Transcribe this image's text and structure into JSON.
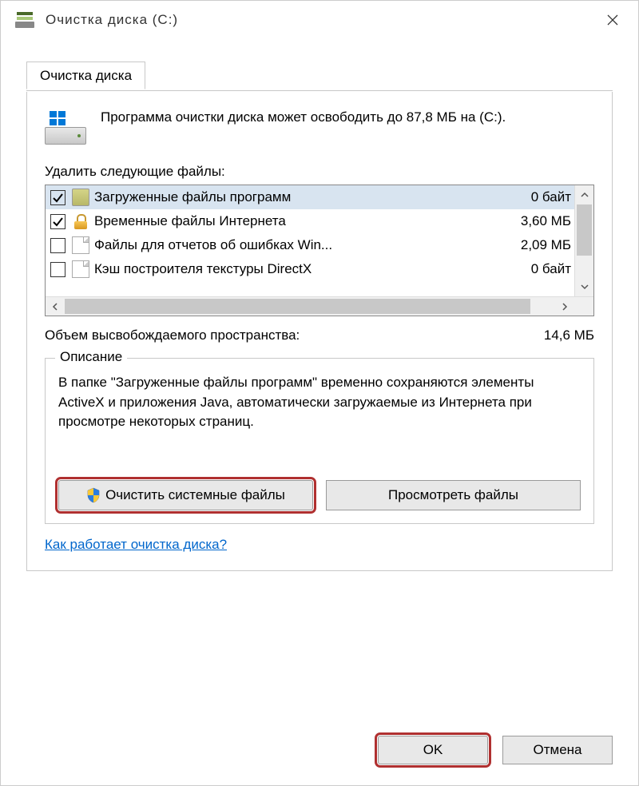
{
  "titlebar": {
    "title": "Очистка диска  (C:)"
  },
  "tab": {
    "label": "Очистка диска"
  },
  "info": {
    "text": "Программа очистки диска может освободить до 87,8 МБ на  (C:)."
  },
  "list": {
    "label": "Удалить следующие файлы:",
    "items": [
      {
        "name": "Загруженные файлы программ",
        "size": "0 байт",
        "checked": true,
        "icon": "folder",
        "selected": true
      },
      {
        "name": "Временные файлы Интернета",
        "size": "3,60 МБ",
        "checked": true,
        "icon": "lock",
        "selected": false
      },
      {
        "name": "Файлы для отчетов об ошибках Win...",
        "size": "2,09 МБ",
        "checked": false,
        "icon": "file",
        "selected": false
      },
      {
        "name": "Кэш построителя текстуры DirectX",
        "size": "0 байт",
        "checked": false,
        "icon": "file",
        "selected": false
      }
    ]
  },
  "total": {
    "label": "Объем высвобождаемого пространства:",
    "value": "14,6 МБ"
  },
  "description": {
    "title": "Описание",
    "text": "В папке \"Загруженные файлы программ\" временно сохраняются элементы ActiveX и приложения Java, автоматически загружаемые из Интернета при просмотре некоторых страниц."
  },
  "buttons": {
    "clean_system": "Очистить системные файлы",
    "view_files": "Просмотреть файлы",
    "ok": "OK",
    "cancel": "Отмена"
  },
  "link": {
    "text": "Как работает очистка диска?"
  }
}
